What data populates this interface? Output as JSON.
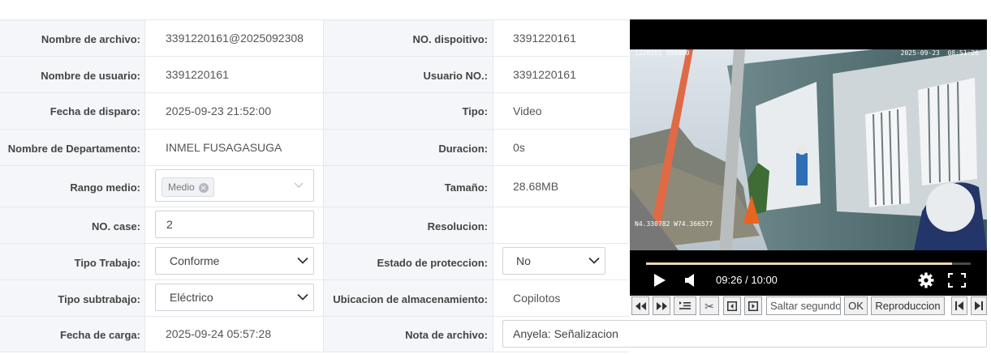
{
  "rows": {
    "nombre_archivo": {
      "label": "Nombre de archivo:",
      "value": "3391220161@2025092308"
    },
    "nombre_usuario": {
      "label": "Nombre de usuario:",
      "value": "3391220161"
    },
    "fecha_disparo": {
      "label": "Fecha de disparo:",
      "value": "2025-09-23 21:52:00"
    },
    "departamento": {
      "label": "Nombre de Departamento:",
      "value": "INMEL FUSAGASUGA"
    },
    "rango_medio": {
      "label": "Rango medio:",
      "tag": "Medio"
    },
    "no_case": {
      "label": "NO. case:",
      "value": "2"
    },
    "tipo_trabajo": {
      "label": "Tipo Trabajo:",
      "value": "Conforme"
    },
    "tipo_subtrabajo": {
      "label": "Tipo subtrabajo:",
      "value": "Eléctrico"
    },
    "fecha_carga": {
      "label": "Fecha de carga:",
      "value": "2025-09-24 05:57:28"
    }
  },
  "rows2": {
    "no_dispositivo": {
      "label": "NO. dispoitivo:",
      "value": "3391220161"
    },
    "usuario_no": {
      "label": "Usuario NO.:",
      "value": "3391220161"
    },
    "tipo": {
      "label": "Tipo:",
      "value": "Video"
    },
    "duracion": {
      "label": "Duracion:",
      "value": "0s"
    },
    "tamano": {
      "label": "Tamaño:",
      "value": "28.68MB"
    },
    "resolucion": {
      "label": "Resolucion:",
      "value": ""
    },
    "estado_proteccion": {
      "label": "Estado de proteccion:",
      "value": "No"
    },
    "ubicacion": {
      "label": "Ubicacion de almacenamiento:",
      "value": "Copilotos"
    },
    "nota": {
      "label": "Nota de archivo:",
      "value": "Anyela: Señalizacion"
    }
  },
  "video": {
    "osd_device": "1220161_000000",
    "osd_datetime": "2025-09-23  08:51:26",
    "osd_gps": "N4.330782  W74.366577",
    "time_display": "09:26 / 10:00",
    "progress": 0.942
  },
  "toolbar": {
    "jump_placeholder": "Saltar segundos",
    "ok_label": "OK",
    "playback_label": "Reproduccion"
  }
}
